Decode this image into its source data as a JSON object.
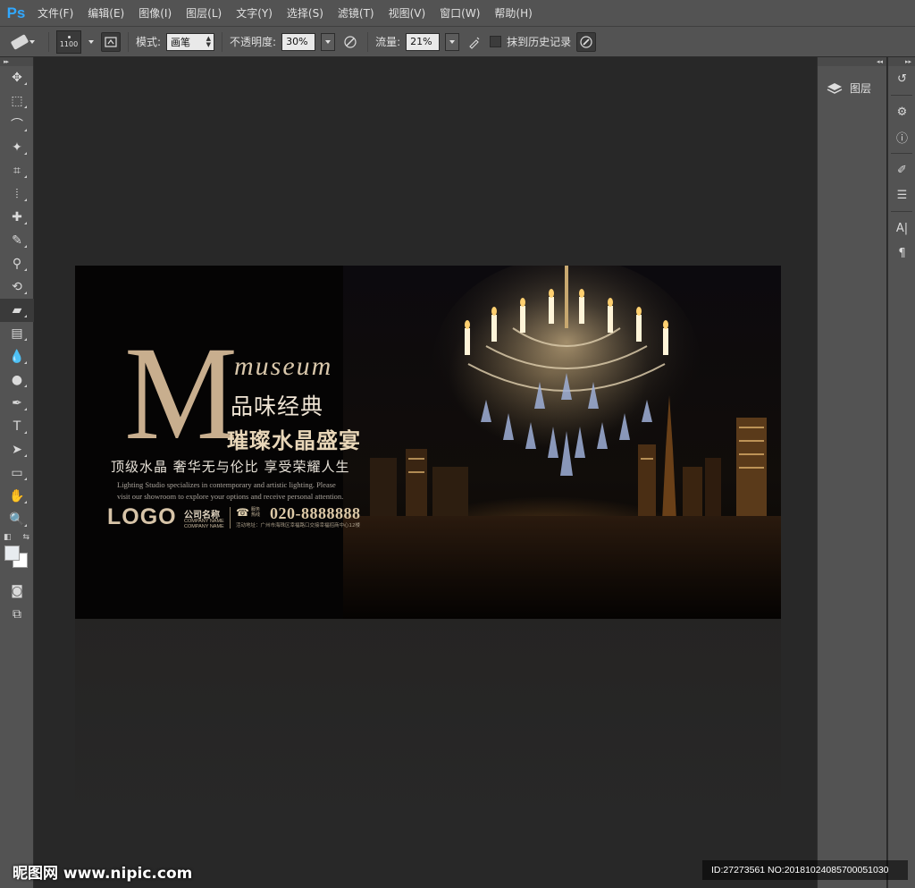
{
  "app": {
    "logo": "Ps"
  },
  "menu": [
    "文件(F)",
    "编辑(E)",
    "图像(I)",
    "图层(L)",
    "文字(Y)",
    "选择(S)",
    "滤镜(T)",
    "视图(V)",
    "窗口(W)",
    "帮助(H)"
  ],
  "options": {
    "brush_size": "1100",
    "mode_label": "模式:",
    "mode_value": "画笔",
    "opacity_label": "不透明度:",
    "opacity_value": "30%",
    "flow_label": "流量:",
    "flow_value": "21%",
    "history_label": "抹到历史记录"
  },
  "tools": [
    "move-icon",
    "marquee-icon",
    "lasso-icon",
    "magic-wand-icon",
    "crop-icon",
    "eyedropper-icon",
    "healing-brush-icon",
    "brush-icon",
    "clone-stamp-icon",
    "history-brush-icon",
    "eraser-icon",
    "gradient-icon",
    "blur-icon",
    "dodge-icon",
    "pen-icon",
    "type-icon",
    "path-selection-icon",
    "shape-icon",
    "hand-icon",
    "zoom-icon"
  ],
  "tool_glyphs": [
    "✥",
    "⬚",
    "⌒",
    "✦",
    "⌗",
    "⦙",
    "✚",
    "✎",
    "⚲",
    "⟲",
    "▰",
    "▤",
    "💧",
    "●",
    "✒",
    "T",
    "➤",
    "▭",
    "✋",
    "🔍"
  ],
  "active_tool_index": 10,
  "panels": {
    "layers_label": "图层"
  },
  "artwork": {
    "big_letter": "M",
    "museum": "museum",
    "title1": "品味经典",
    "title2": "璀璨水晶盛宴",
    "slogan": "顶级水晶  奢华无与伦比  享受荣耀人生",
    "english1": "Lighting Studio specializes in contemporary and artistic lighting. Please",
    "english2": "visit our showroom to explore your options and receive personal attention.",
    "logo": "LOGO",
    "company_cn": "公司名称",
    "company_en1": "COMPANY NAME",
    "company_en2": "COMPANY NAME",
    "tel_label": "服务热线",
    "phone": "020-8888888",
    "address": "活动地址：广州市海珠区幸福路口交接幸福招商中心12楼"
  },
  "watermark": {
    "left": "昵图网 www.nipic.com",
    "right": "ID:27273561 NO:20181024085700051030"
  },
  "colors": {
    "accent_gold": "#c8ae8e",
    "ps_blue": "#31a8ff",
    "chrome": "#535353",
    "canvas_bg": "#282828"
  }
}
